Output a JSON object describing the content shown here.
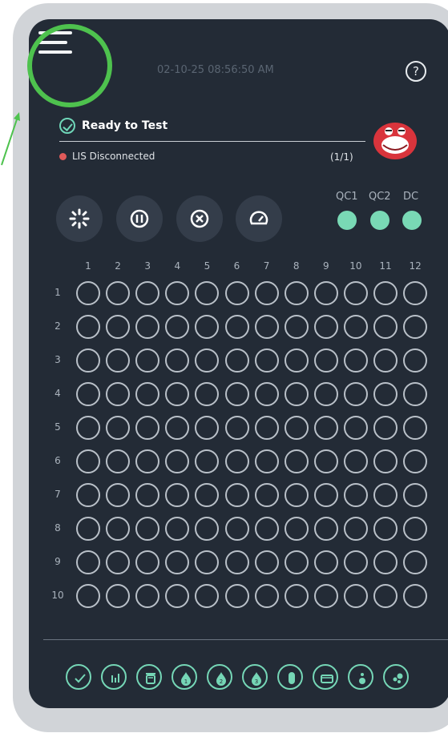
{
  "header": {
    "datetime": "02-10-25 08:56:50 AM",
    "help_symbol": "?"
  },
  "status": {
    "ready_text": "Ready to Test",
    "lis_text": "LIS Disconnected",
    "count": "(1/1)"
  },
  "controls": [
    "loading-icon",
    "pause-icon",
    "stop-icon",
    "gauge-icon"
  ],
  "qc": {
    "labels": [
      "QC1",
      "QC2",
      "DC"
    ],
    "color": "#79d9b5"
  },
  "plate": {
    "columns": [
      "1",
      "2",
      "3",
      "4",
      "5",
      "6",
      "7",
      "8",
      "9",
      "10",
      "11",
      "12"
    ],
    "rows": [
      "1",
      "2",
      "3",
      "4",
      "5",
      "6",
      "7",
      "8",
      "9",
      "10"
    ]
  },
  "toolbar": {
    "icons": [
      "check-icon",
      "bar-chart-icon",
      "trash-icon",
      "drop-1-icon",
      "drop-2-icon",
      "drop-3-icon",
      "tube-icon",
      "cassette-icon",
      "info-icon",
      "dots-icon"
    ],
    "drop_numbers": [
      "1",
      "2",
      "3"
    ]
  },
  "colors": {
    "accent": "#79d9b5",
    "background": "#232b36",
    "highlight": "#4ec24e",
    "alert": "#e05a5a"
  }
}
